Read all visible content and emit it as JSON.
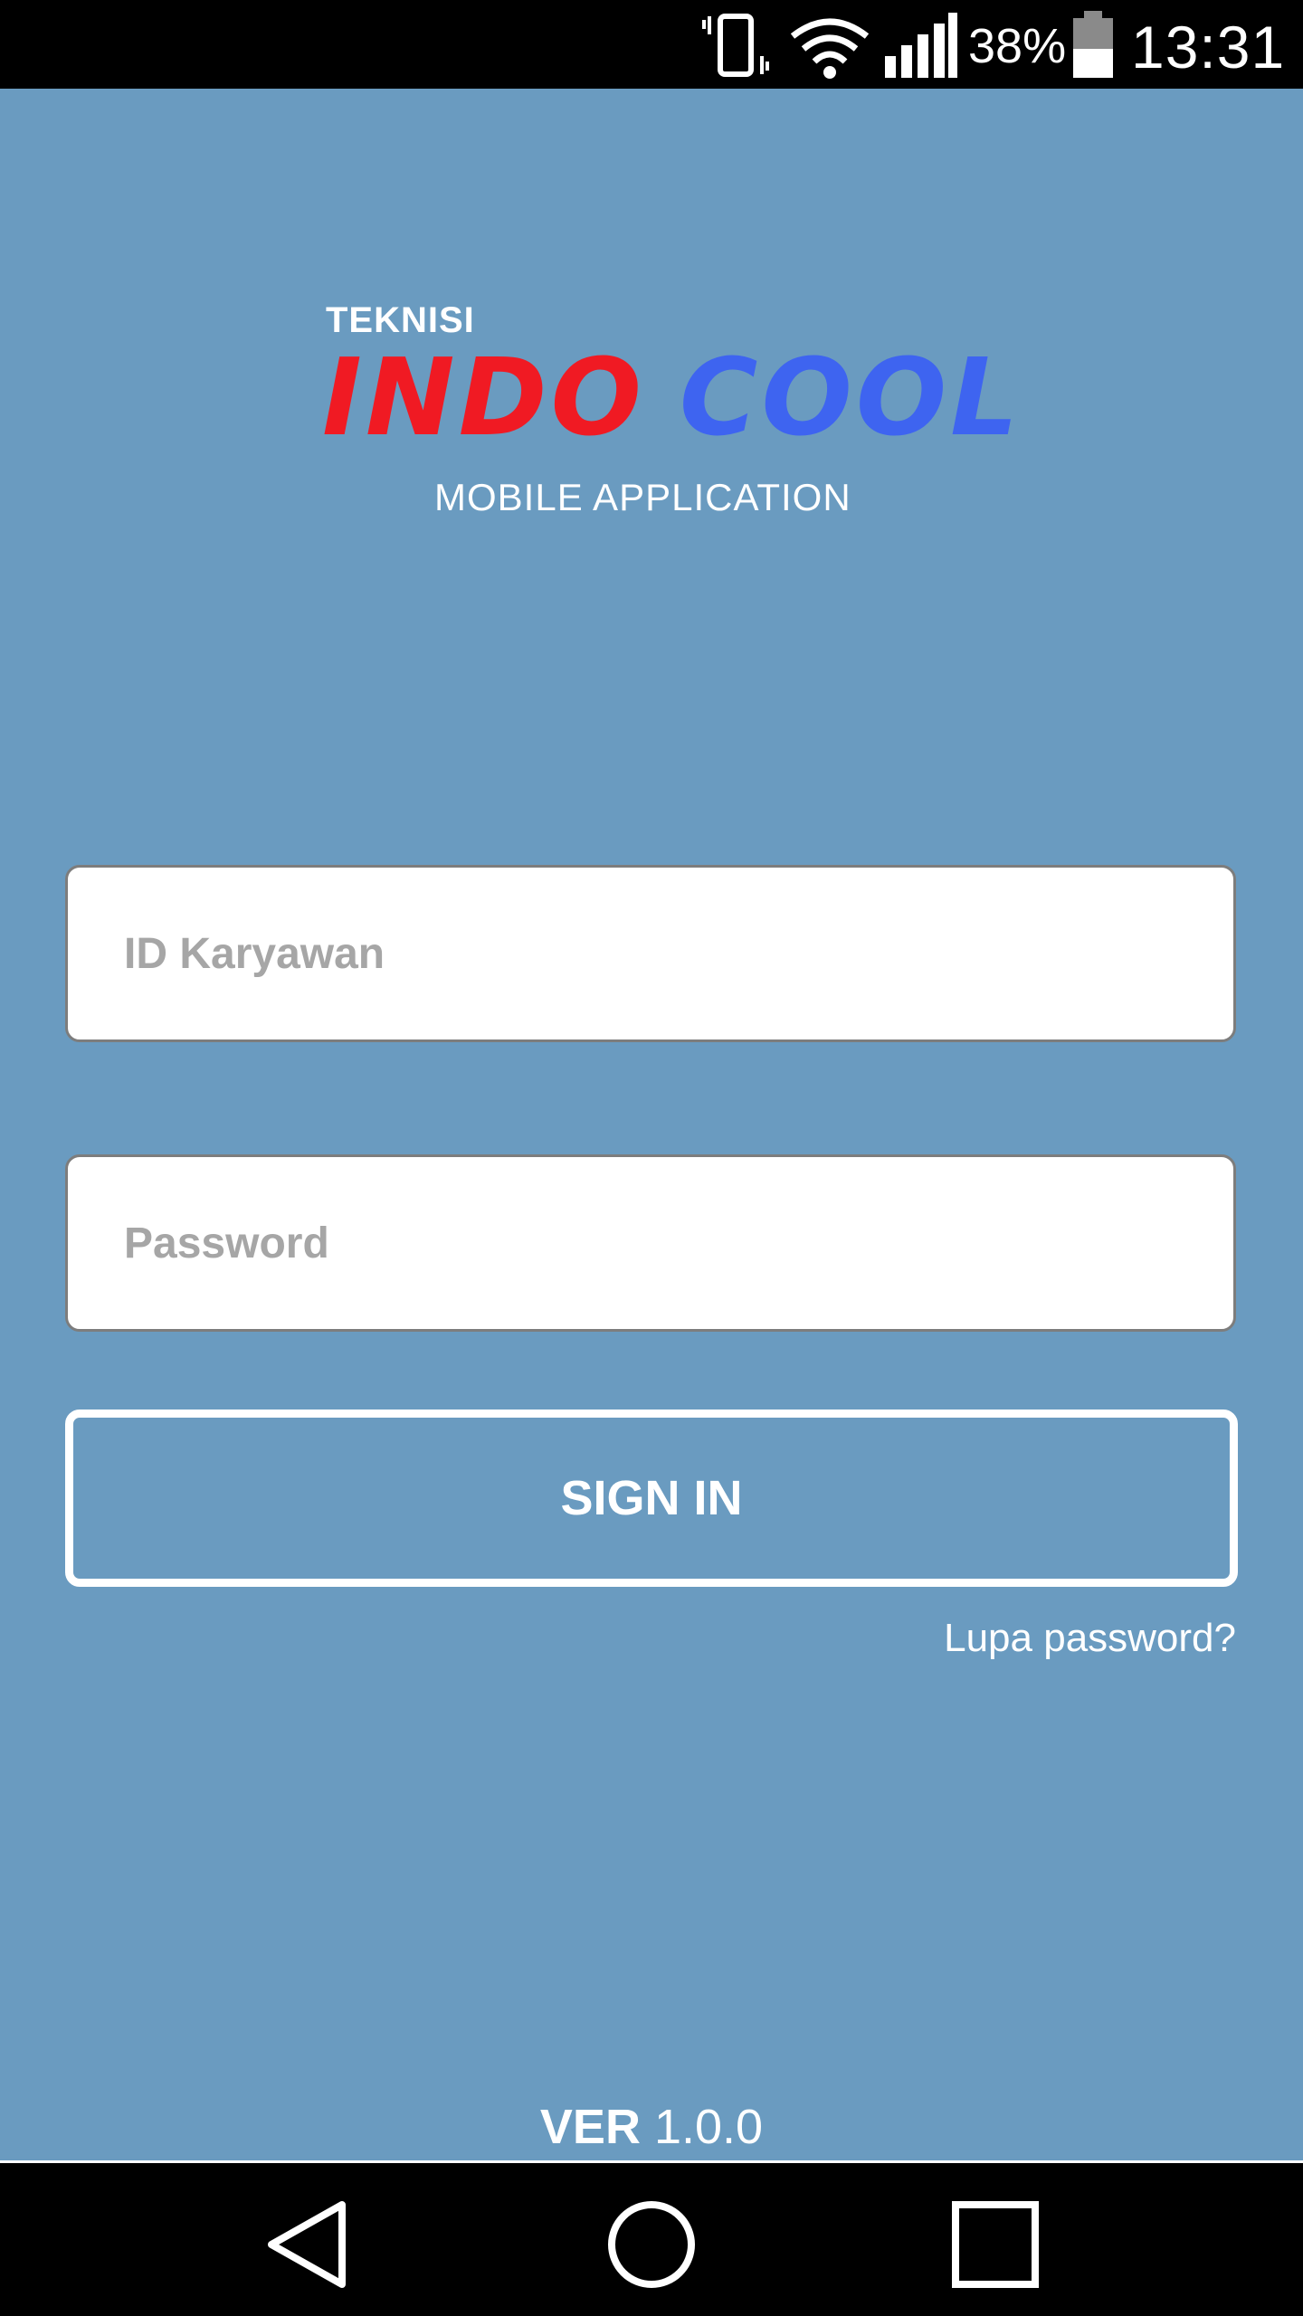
{
  "status_bar": {
    "battery_percent": "38%",
    "time": "13:31",
    "icons": [
      "vibrate-icon",
      "wifi-icon",
      "signal-icon",
      "battery-icon"
    ]
  },
  "logo": {
    "prefix": "TEKNISI",
    "brand_red": "INDO",
    "brand_blue": "COOL",
    "subtitle": "MOBILE APPLICATION"
  },
  "login": {
    "id_placeholder": "ID Karyawan",
    "id_value": "",
    "password_placeholder": "Password",
    "password_value": "",
    "sign_in_label": "SIGN IN",
    "forgot_label": "Lupa password?"
  },
  "version": {
    "label": "VER",
    "number": "1.0.0"
  },
  "nav_bar": {
    "icons": [
      "back-icon",
      "home-icon",
      "recent-apps-icon"
    ]
  },
  "colors": {
    "background": "#6a9bc0",
    "brand_red": "#f01a23",
    "brand_blue": "#3e64f0",
    "bars": "#000000"
  }
}
